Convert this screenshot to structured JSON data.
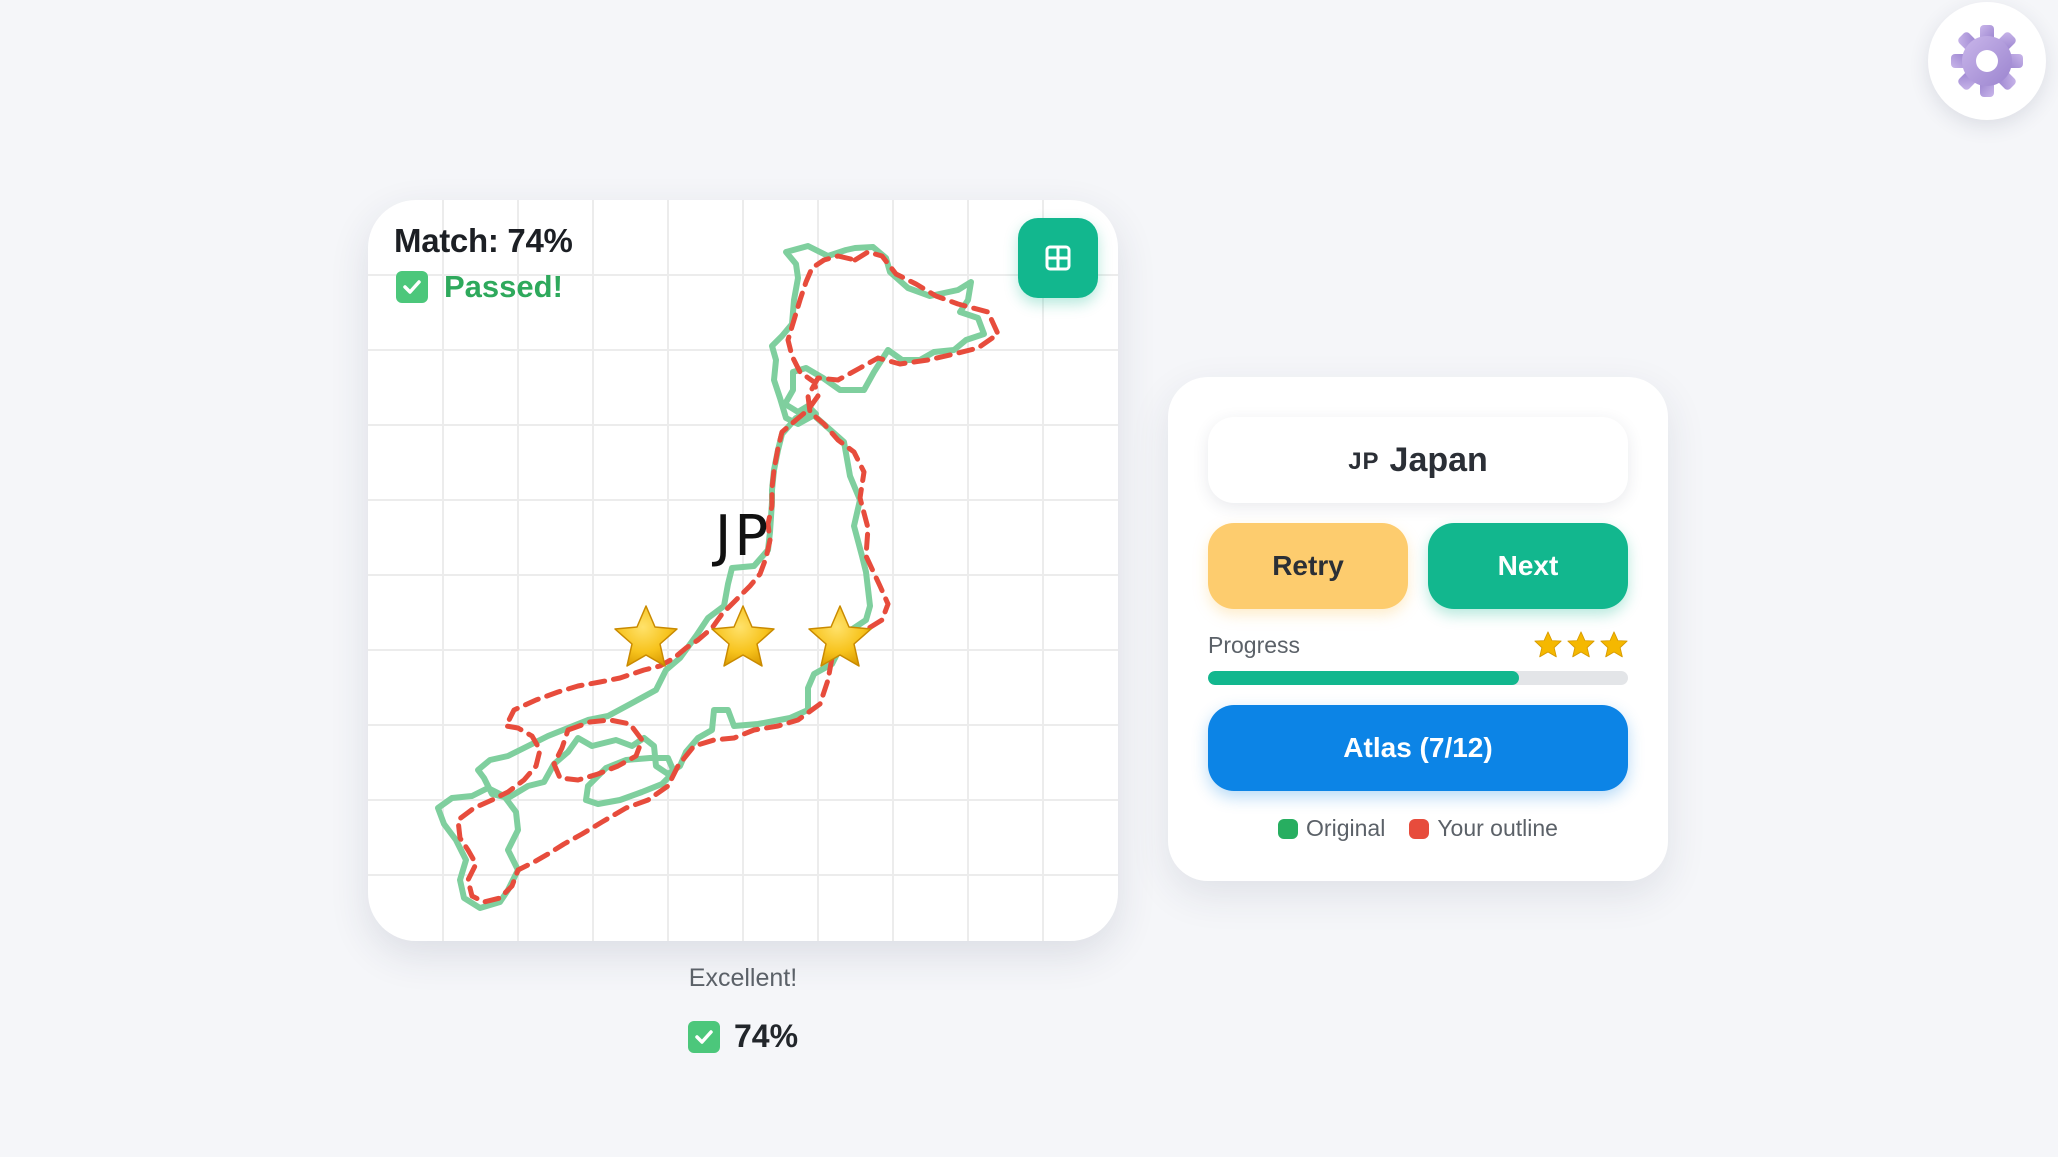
{
  "game": {
    "match_label": "Match: 74%",
    "passed_label": "Passed!",
    "country_code": "JP",
    "stars_earned": 3,
    "stars_total": 3,
    "caption": "Excellent!",
    "score_label": "74%"
  },
  "panel": {
    "country_code": "JP",
    "country_name": "Japan",
    "retry_label": "Retry",
    "next_label": "Next",
    "progress_label": "Progress",
    "progress_fraction": 0.74,
    "atlas_label": "Atlas (7/12)",
    "legend": [
      {
        "label": "Original",
        "color": "#27ae60"
      },
      {
        "label": "Your outline",
        "color": "#e74c3c"
      }
    ]
  },
  "icons": {
    "settings": "gear-icon",
    "grid_toggle": "grid-icon",
    "passed": "check-icon",
    "star": "star-icon"
  },
  "colors": {
    "accent": "#12b78e",
    "retry": "#fdcc6e",
    "atlas": "#0c84e6",
    "original_outline": "#7fcf9e",
    "user_outline": "#e74c3c",
    "star": "#f5b800"
  }
}
